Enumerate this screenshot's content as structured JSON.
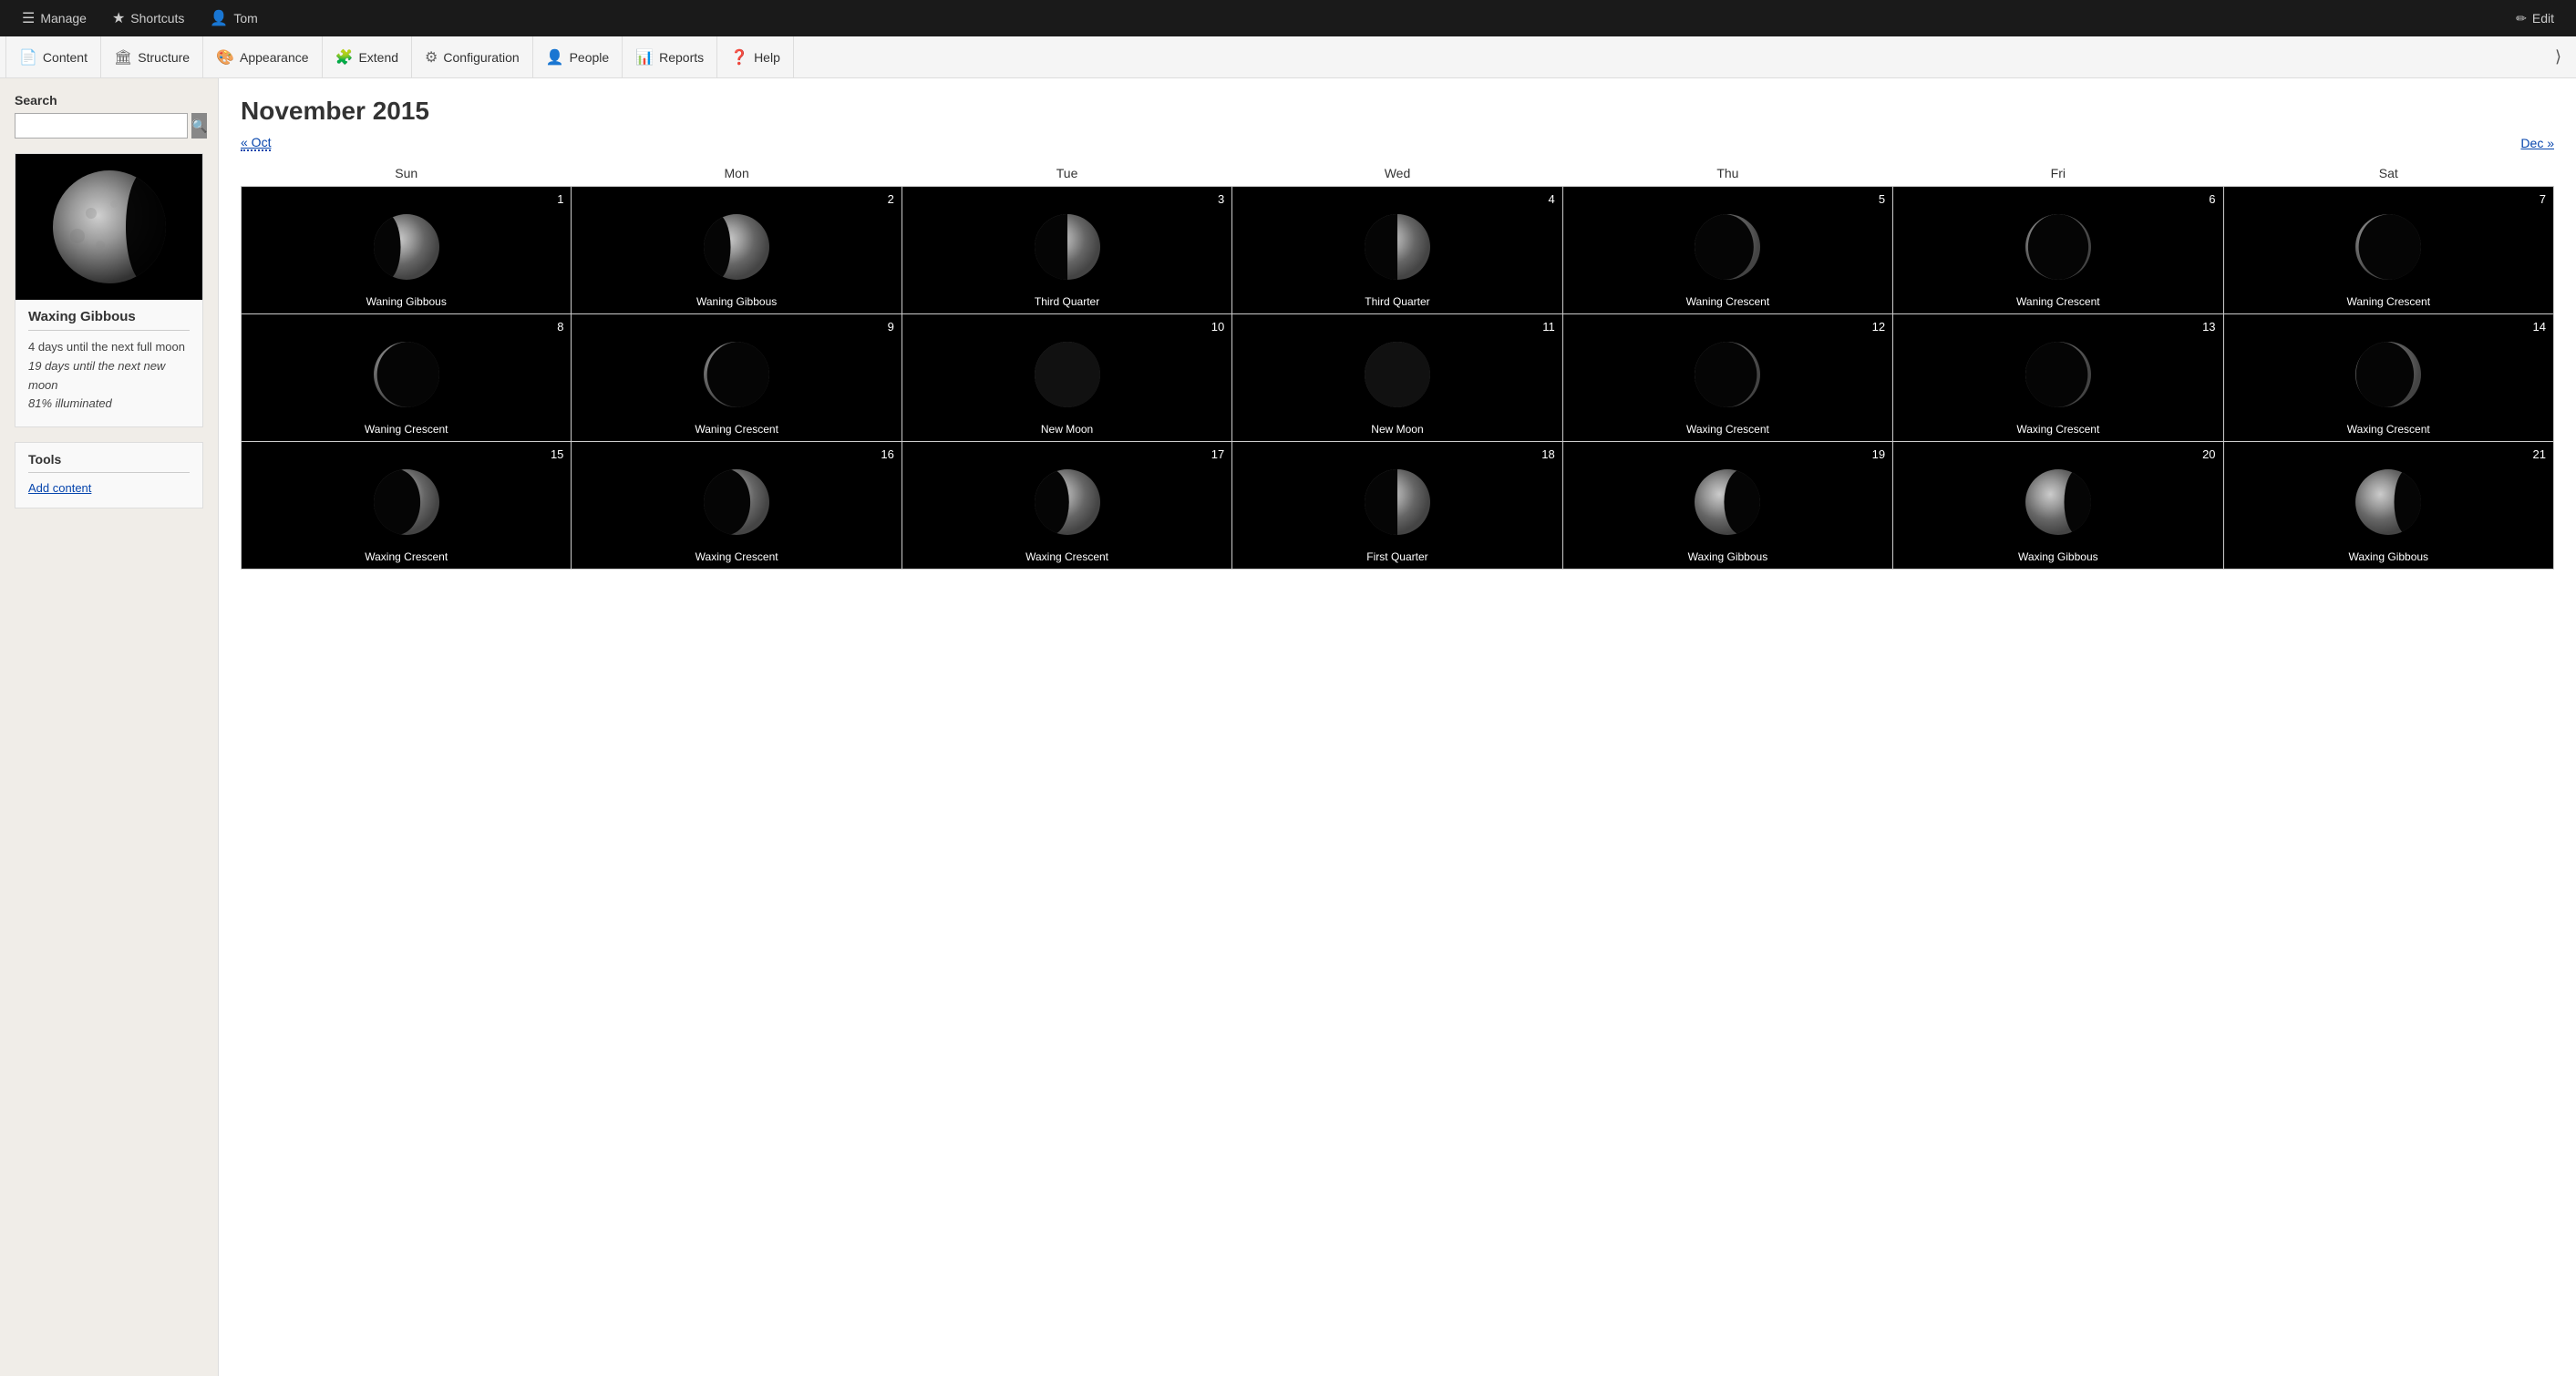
{
  "topBar": {
    "manage": "Manage",
    "shortcuts": "Shortcuts",
    "user": "Tom",
    "edit": "Edit"
  },
  "secNav": {
    "items": [
      {
        "label": "Content",
        "icon": "📄"
      },
      {
        "label": "Structure",
        "icon": "🏛"
      },
      {
        "label": "Appearance",
        "icon": "🎨"
      },
      {
        "label": "Extend",
        "icon": "🧩"
      },
      {
        "label": "Configuration",
        "icon": "⚙"
      },
      {
        "label": "People",
        "icon": "👤"
      },
      {
        "label": "Reports",
        "icon": "📊"
      },
      {
        "label": "Help",
        "icon": "❓"
      }
    ]
  },
  "sidebar": {
    "searchLabel": "Search",
    "searchPlaceholder": "",
    "moonPhase": "Waxing Gibbous",
    "stat1": "4 days until the next full moon",
    "stat2": "19 days until the next new moon",
    "stat3": "81% illuminated",
    "toolsLabel": "Tools",
    "addContentLink": "Add content"
  },
  "calendar": {
    "title": "November 2015",
    "prevLink": "« Oct",
    "nextLink": "Dec »",
    "dayHeaders": [
      "Sun",
      "Mon",
      "Tue",
      "Wed",
      "Thu",
      "Fri",
      "Sat"
    ],
    "weeks": [
      [
        {
          "num": 1,
          "phase": "Waning Gibbous",
          "moonType": "waning-gibbous"
        },
        {
          "num": 2,
          "phase": "Waning Gibbous",
          "moonType": "waning-gibbous"
        },
        {
          "num": 3,
          "phase": "Third Quarter",
          "moonType": "third-quarter"
        },
        {
          "num": 4,
          "phase": "Third Quarter",
          "moonType": "third-quarter"
        },
        {
          "num": 5,
          "phase": "Waning Crescent",
          "moonType": "waning-crescent-early"
        },
        {
          "num": 6,
          "phase": "Waning Crescent",
          "moonType": "waning-crescent-mid"
        },
        {
          "num": 7,
          "phase": "Waning Crescent",
          "moonType": "waning-crescent-late"
        }
      ],
      [
        {
          "num": 8,
          "phase": "Waning Crescent",
          "moonType": "waning-crescent-thin"
        },
        {
          "num": 9,
          "phase": "Waning Crescent",
          "moonType": "waning-crescent-thin"
        },
        {
          "num": 10,
          "phase": "New Moon",
          "moonType": "new-moon"
        },
        {
          "num": 11,
          "phase": "New Moon",
          "moonType": "new-moon"
        },
        {
          "num": 12,
          "phase": "Waxing Crescent",
          "moonType": "waxing-crescent-thin"
        },
        {
          "num": 13,
          "phase": "Waxing Crescent",
          "moonType": "waxing-crescent-thin"
        },
        {
          "num": 14,
          "phase": "Waxing Crescent",
          "moonType": "waxing-crescent-early"
        }
      ],
      [
        {
          "num": 15,
          "phase": "Waxing Crescent",
          "moonType": "waxing-crescent-mid"
        },
        {
          "num": 16,
          "phase": "Waxing Crescent",
          "moonType": "waxing-crescent-mid"
        },
        {
          "num": 17,
          "phase": "Waxing Crescent",
          "moonType": "waxing-crescent-late"
        },
        {
          "num": 18,
          "phase": "First Quarter",
          "moonType": "first-quarter"
        },
        {
          "num": 19,
          "phase": "Waxing Gibbous",
          "moonType": "waxing-gibbous-early"
        },
        {
          "num": 20,
          "phase": "Waxing Gibbous",
          "moonType": "waxing-gibbous-mid"
        },
        {
          "num": 21,
          "phase": "Waxing Gibbous",
          "moonType": "waxing-gibbous-mid"
        }
      ]
    ]
  }
}
